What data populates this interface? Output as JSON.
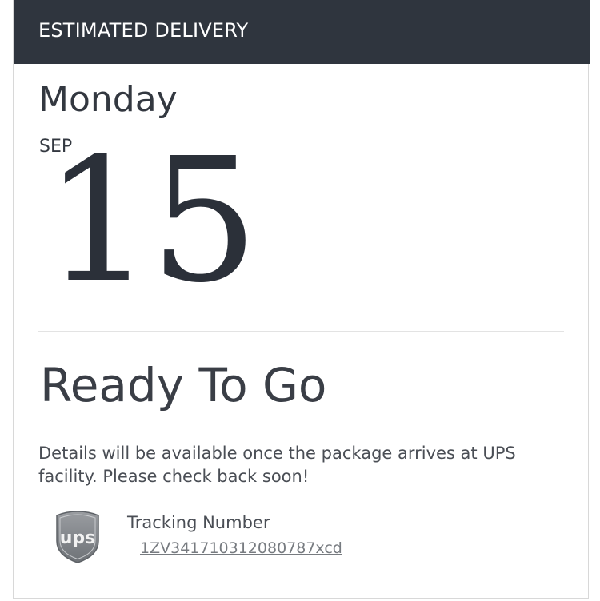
{
  "header": {
    "title": "ESTIMATED DELIVERY"
  },
  "delivery": {
    "weekday": "Monday",
    "month": "SEP",
    "day": "15"
  },
  "status": {
    "title": "Ready To Go",
    "details": "Details will be available once the package arrives at UPS facility. Please check back soon!"
  },
  "tracking": {
    "carrier_logo_text": "ups",
    "carrier_icon": "ups-shield-icon",
    "label": "Tracking Number",
    "number": "1ZV341710312080787xcd"
  }
}
